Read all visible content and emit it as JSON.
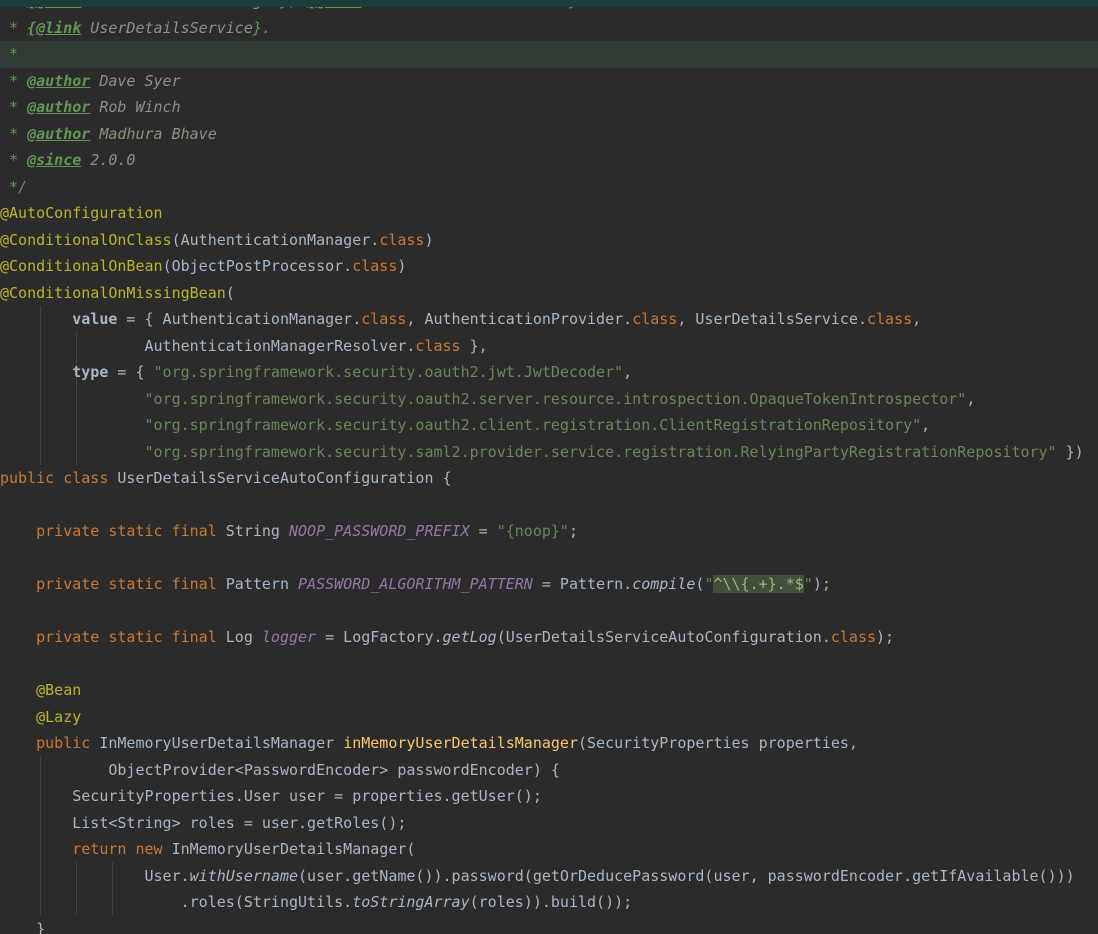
{
  "editor": {
    "background": "#2b2b2b",
    "caret_line_background": "#313a33",
    "top_strip_color": "#1d3d3a",
    "token_colors": {
      "default": "#a9b7c6",
      "keyword": "#cc7832",
      "annotation": "#bbb529",
      "string": "#6a8759",
      "comment": "#629755",
      "doc_tag_value": "#8a9480",
      "static_field": "#9876aa",
      "method_declaration": "#ffc66b",
      "regex_highlight_bg": "#414f3d"
    },
    "lines": [
      {
        "clipped": true,
        "tokens": [
          [
            "c",
            " * "
          ],
          [
            "ct",
            "{@link"
          ],
          [
            "cv",
            " AuthenticationManager"
          ],
          [
            "c",
            "}, "
          ],
          [
            "ct",
            "{@link"
          ],
          [
            "cv",
            " AuthenticationProvider"
          ],
          [
            "c",
            "} or"
          ]
        ]
      },
      {
        "tokens": [
          [
            "c",
            " * "
          ],
          [
            "ct",
            "{@link"
          ],
          [
            "cv",
            " UserDetailsService"
          ],
          [
            "c",
            "}."
          ]
        ]
      },
      {
        "highlight": "caret",
        "tokens": [
          [
            "c",
            " *"
          ]
        ]
      },
      {
        "tokens": [
          [
            "c",
            " * "
          ],
          [
            "ct",
            "@author"
          ],
          [
            "cv",
            " Dave Syer"
          ]
        ]
      },
      {
        "tokens": [
          [
            "c",
            " * "
          ],
          [
            "ct",
            "@author"
          ],
          [
            "cv",
            " Rob Winch"
          ]
        ]
      },
      {
        "tokens": [
          [
            "c",
            " * "
          ],
          [
            "ct",
            "@author"
          ],
          [
            "cv",
            " Madhura Bhave"
          ]
        ]
      },
      {
        "tokens": [
          [
            "c",
            " * "
          ],
          [
            "ct",
            "@since"
          ],
          [
            "cv",
            " 2.0.0"
          ]
        ]
      },
      {
        "tokens": [
          [
            "c",
            " */"
          ]
        ]
      },
      {
        "tokens": [
          [
            "a",
            "@AutoConfiguration"
          ]
        ]
      },
      {
        "tokens": [
          [
            "a",
            "@ConditionalOnClass"
          ],
          [
            "d",
            "(AuthenticationManager."
          ],
          [
            "k",
            "class"
          ],
          [
            "d",
            ")"
          ]
        ]
      },
      {
        "tokens": [
          [
            "a",
            "@ConditionalOnBean"
          ],
          [
            "d",
            "(ObjectPostProcessor."
          ],
          [
            "k",
            "class"
          ],
          [
            "d",
            ")"
          ]
        ]
      },
      {
        "tokens": [
          [
            "a",
            "@ConditionalOnMissingBean"
          ],
          [
            "d",
            "("
          ]
        ]
      },
      {
        "tokens": [
          [
            "d",
            "        "
          ],
          [
            "b",
            "value"
          ],
          [
            "d",
            " = { AuthenticationManager."
          ],
          [
            "k",
            "class"
          ],
          [
            "d",
            ", AuthenticationProvider."
          ],
          [
            "k",
            "class"
          ],
          [
            "d",
            ", UserDetailsService."
          ],
          [
            "k",
            "class"
          ],
          [
            "d",
            ","
          ]
        ]
      },
      {
        "tokens": [
          [
            "d",
            "                AuthenticationManagerResolver."
          ],
          [
            "k",
            "class"
          ],
          [
            "d",
            " },"
          ]
        ]
      },
      {
        "tokens": [
          [
            "d",
            "        "
          ],
          [
            "b",
            "type"
          ],
          [
            "d",
            " = { "
          ],
          [
            "s",
            "\"org.springframework.security.oauth2.jwt.JwtDecoder\""
          ],
          [
            "d",
            ","
          ]
        ]
      },
      {
        "tokens": [
          [
            "d",
            "                "
          ],
          [
            "s",
            "\"org.springframework.security.oauth2.server.resource.introspection.OpaqueTokenIntrospector\""
          ],
          [
            "d",
            ","
          ]
        ]
      },
      {
        "tokens": [
          [
            "d",
            "                "
          ],
          [
            "s",
            "\"org.springframework.security.oauth2.client.registration.ClientRegistrationRepository\""
          ],
          [
            "d",
            ","
          ]
        ]
      },
      {
        "tokens": [
          [
            "d",
            "                "
          ],
          [
            "s",
            "\"org.springframework.security.saml2.provider.service.registration.RelyingPartyRegistrationRepository\""
          ],
          [
            "d",
            " })"
          ]
        ]
      },
      {
        "tokens": [
          [
            "k",
            "public class"
          ],
          [
            "d",
            " UserDetailsServiceAutoConfiguration {"
          ]
        ]
      },
      {
        "tokens": []
      },
      {
        "tokens": [
          [
            "d",
            "    "
          ],
          [
            "k",
            "private static final"
          ],
          [
            "d",
            " String "
          ],
          [
            "f",
            "NOOP_PASSWORD_PREFIX"
          ],
          [
            "d",
            " = "
          ],
          [
            "s",
            "\"{noop}\""
          ],
          [
            "d",
            ";"
          ]
        ]
      },
      {
        "tokens": []
      },
      {
        "tokens": [
          [
            "d",
            "    "
          ],
          [
            "k",
            "private static final"
          ],
          [
            "d",
            " Pattern "
          ],
          [
            "f",
            "PASSWORD_ALGORITHM_PATTERN"
          ],
          [
            "d",
            " = Pattern."
          ],
          [
            "sm",
            "compile"
          ],
          [
            "d",
            "("
          ],
          [
            "s",
            "\""
          ],
          [
            "rx",
            "^\\\\{.+}.*$"
          ],
          [
            "s",
            "\""
          ],
          [
            "d",
            ");"
          ]
        ]
      },
      {
        "tokens": []
      },
      {
        "tokens": [
          [
            "d",
            "    "
          ],
          [
            "k",
            "private static final"
          ],
          [
            "d",
            " Log "
          ],
          [
            "f",
            "logger"
          ],
          [
            "d",
            " = LogFactory."
          ],
          [
            "sm",
            "getLog"
          ],
          [
            "d",
            "(UserDetailsServiceAutoConfiguration."
          ],
          [
            "k",
            "class"
          ],
          [
            "d",
            ");"
          ]
        ]
      },
      {
        "tokens": []
      },
      {
        "tokens": [
          [
            "d",
            "    "
          ],
          [
            "a",
            "@Bean"
          ]
        ]
      },
      {
        "tokens": [
          [
            "d",
            "    "
          ],
          [
            "a",
            "@Lazy"
          ]
        ]
      },
      {
        "tokens": [
          [
            "d",
            "    "
          ],
          [
            "k",
            "public"
          ],
          [
            "d",
            " InMemoryUserDetailsManager "
          ],
          [
            "m",
            "inMemoryUserDetailsManager"
          ],
          [
            "d",
            "(SecurityProperties properties,"
          ]
        ]
      },
      {
        "tokens": [
          [
            "d",
            "            ObjectProvider<PasswordEncoder> passwordEncoder) {"
          ]
        ]
      },
      {
        "tokens": [
          [
            "d",
            "        SecurityProperties.User user = properties.getUser();"
          ]
        ]
      },
      {
        "tokens": [
          [
            "d",
            "        List<String> roles = user.getRoles();"
          ]
        ]
      },
      {
        "tokens": [
          [
            "d",
            "        "
          ],
          [
            "k",
            "return new"
          ],
          [
            "d",
            " InMemoryUserDetailsManager("
          ]
        ]
      },
      {
        "tokens": [
          [
            "d",
            "                User."
          ],
          [
            "sm",
            "withUsername"
          ],
          [
            "d",
            "(user.getName()).password(getOrDeducePassword(user, passwordEncoder.getIfAvailable()))"
          ]
        ]
      },
      {
        "tokens": [
          [
            "d",
            "                    .roles(StringUtils."
          ],
          [
            "sm",
            "toStringArray"
          ],
          [
            "d",
            "(roles)).build());"
          ]
        ]
      },
      {
        "tokens": [
          [
            "d",
            "    }"
          ]
        ]
      }
    ]
  }
}
